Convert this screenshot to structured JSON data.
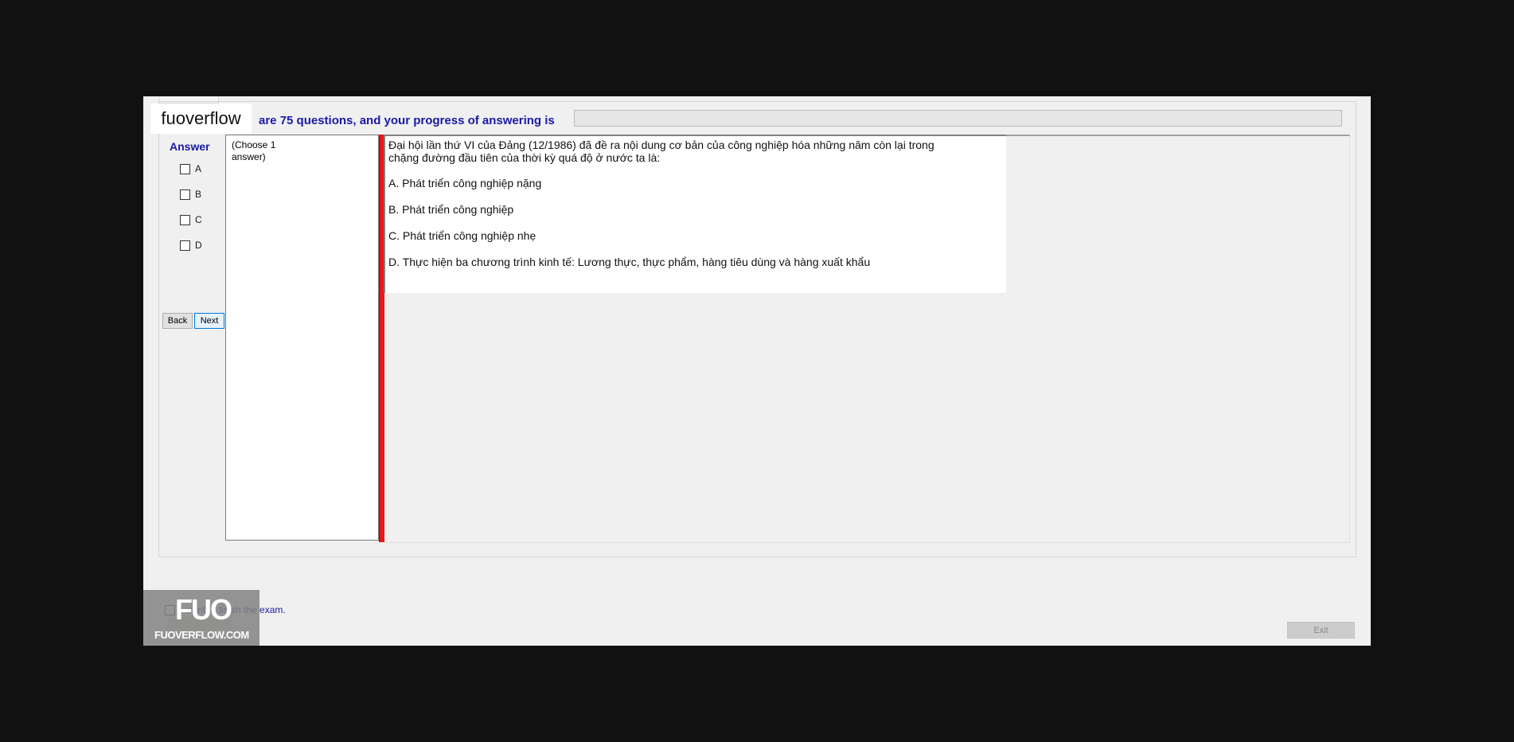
{
  "header": {
    "progress_text": "are 75 questions, and your progress of answering is",
    "progress_value": 0
  },
  "answer_panel": {
    "title": "Answer",
    "options": [
      "A",
      "B",
      "C",
      "D"
    ],
    "back_label": "Back",
    "next_label": "Next"
  },
  "list": {
    "hint": "(Choose 1 answer)"
  },
  "question": {
    "text_line1": "Đại hội lần thứ VI của Đảng (12/1986) đã đề ra nội dung cơ bản của công nghiệp hóa những năm còn lại trong",
    "text_line2": "chặng đường đầu tiên của thời kỳ quá độ ở nước ta là:",
    "options": [
      "A.  Phát triển công nghiệp nặng",
      "B.  Phát triển công nghiệp",
      "C.  Phát triển công nghiệp nhẹ",
      "D.  Thực hiện ba chương trình kinh tế: Lương thực, thực phẩm, hàng tiêu dùng và hàng xuất khẩu"
    ]
  },
  "footer": {
    "finish_label": "I want to finish the exam.",
    "exit_label": "Exit"
  },
  "watermark": {
    "text": "fuoverflow",
    "logo_big": "FUO",
    "logo_small": "FUOVERFLOW.COM"
  }
}
